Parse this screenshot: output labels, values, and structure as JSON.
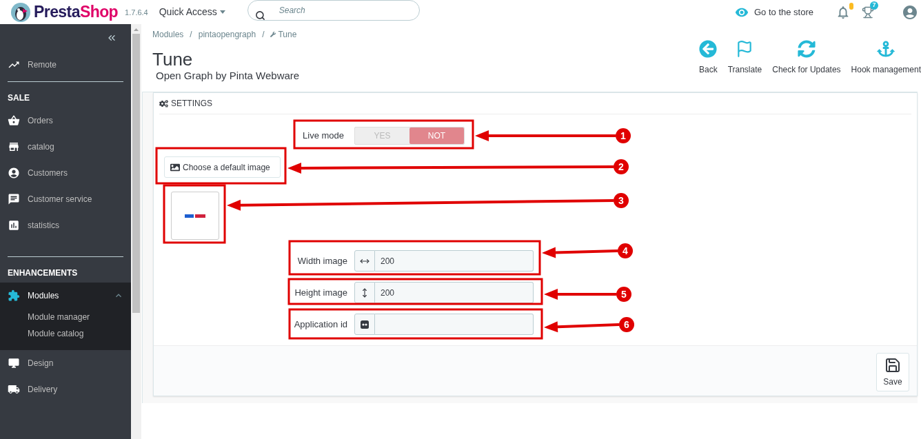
{
  "header": {
    "logo": {
      "part_1": "Presta",
      "part_2": "Shop"
    },
    "version": "1.7.6.4",
    "quick_access": "Quick Access",
    "search": {
      "placeholder": "Search"
    },
    "store_link": "Go to the store",
    "trophy_badge": "7"
  },
  "sidebar": {
    "sections": [
      {
        "items": [
          {
            "label": "Remote",
            "selected": false
          }
        ]
      },
      {
        "title": "SALE",
        "items": [
          {
            "label": "Orders",
            "selected": false
          },
          {
            "label": "catalog",
            "selected": false
          },
          {
            "label": "Customers",
            "selected": false
          },
          {
            "label": "Customer service",
            "selected": false
          },
          {
            "label": "statistics",
            "selected": false
          }
        ]
      },
      {
        "title": "ENHANCEMENTS",
        "items": [
          {
            "label": "Modules",
            "selected": true,
            "expanded": true,
            "children": [
              {
                "label": "Module manager"
              },
              {
                "label": "Module catalog"
              }
            ]
          },
          {
            "label": "Design",
            "selected": false
          },
          {
            "label": "Delivery",
            "selected": false
          }
        ]
      }
    ]
  },
  "breadcrumb": {
    "items": [
      "Modules",
      "pintaopengraph",
      "Tune"
    ],
    "separators": [
      "/",
      "/"
    ]
  },
  "page": {
    "title": "Tune",
    "subtitle": "Open Graph by Pinta Webware"
  },
  "toolbar": [
    "Back",
    "Translate",
    "Check for Updates",
    "Hook management"
  ],
  "panel": {
    "heading": "SETTINGS",
    "live_mode": {
      "label": "Live mode",
      "options": [
        {
          "label": "YES",
          "selected": false
        },
        {
          "label": "NOT",
          "selected": true
        }
      ]
    },
    "image_button": "Choose a default image",
    "inputs": [
      {
        "label": "Width image",
        "value": "200"
      },
      {
        "label": "Height image",
        "value": "200"
      },
      {
        "label": "Application id"
      }
    ],
    "save": "Save"
  },
  "annotations": [
    "1",
    "2",
    "3",
    "4",
    "5",
    "6"
  ]
}
